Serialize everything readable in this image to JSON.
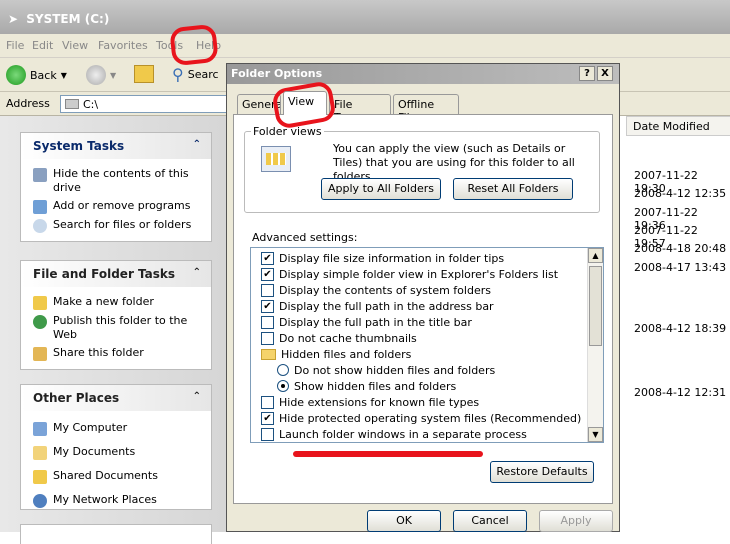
{
  "window": {
    "title": "SYSTEM (C:)"
  },
  "menu": [
    "File",
    "Edit",
    "View",
    "Favorites",
    "Tools",
    "Help"
  ],
  "toolbar": {
    "back_label": "Back",
    "search_label": "Searc"
  },
  "address": {
    "label": "Address",
    "value": "C:\\"
  },
  "left_pane": {
    "system_tasks": {
      "title": "System Tasks",
      "items": [
        "Hide the contents of this drive",
        "Add or remove programs",
        "Search for files or folders"
      ]
    },
    "file_tasks": {
      "title": "File and Folder Tasks",
      "items": [
        "Make a new folder",
        "Publish this folder to the Web",
        "Share this folder"
      ]
    },
    "other_places": {
      "title": "Other Places",
      "items": [
        "My Computer",
        "My Documents",
        "Shared Documents",
        "My Network Places"
      ]
    }
  },
  "details": {
    "column_header": "Date Modified",
    "dates": [
      "2007-11-22 19:30",
      "2008-4-12 12:35",
      "2007-11-22 19:36",
      "2007-11-22 19:57",
      "2008-4-18 20:48",
      "2008-4-17 13:43",
      "2008-4-12 18:39",
      "2008-4-12 12:31"
    ]
  },
  "dialog": {
    "title": "Folder Options",
    "help_btn": "?",
    "close_btn": "X",
    "tabs": [
      "General",
      "View",
      "File Types",
      "Offline Files"
    ],
    "active_tab": "View",
    "folder_views": {
      "legend": "Folder views",
      "text": "You can apply the view (such as Details or Tiles) that you are using for this folder to all folders.",
      "apply_btn": "Apply to All Folders",
      "reset_btn": "Reset All Folders"
    },
    "advanced_label": "Advanced settings:",
    "settings": [
      {
        "kind": "checkbox",
        "checked": true,
        "label": "Display file size information in folder tips"
      },
      {
        "kind": "checkbox",
        "checked": true,
        "label": "Display simple folder view in Explorer's Folders list"
      },
      {
        "kind": "checkbox",
        "checked": false,
        "label": "Display the contents of system folders"
      },
      {
        "kind": "checkbox",
        "checked": true,
        "label": "Display the full path in the address bar"
      },
      {
        "kind": "checkbox",
        "checked": false,
        "label": "Display the full path in the title bar"
      },
      {
        "kind": "checkbox",
        "checked": false,
        "label": "Do not cache thumbnails"
      },
      {
        "kind": "folder",
        "label": "Hidden files and folders"
      },
      {
        "kind": "radio",
        "checked": false,
        "label": "Do not show hidden files and folders"
      },
      {
        "kind": "radio",
        "checked": true,
        "label": "Show hidden files and folders"
      },
      {
        "kind": "checkbox",
        "checked": false,
        "label": "Hide extensions for known file types"
      },
      {
        "kind": "checkbox",
        "checked": true,
        "label": "Hide protected operating system files (Recommended)"
      },
      {
        "kind": "checkbox",
        "checked": false,
        "label": "Launch folder windows in a separate process"
      }
    ],
    "restore_btn": "Restore Defaults",
    "ok_btn": "OK",
    "cancel_btn": "Cancel",
    "apply_btn": "Apply"
  },
  "colors": {
    "annotation_red": "#e8141c",
    "accent": "#003c74"
  }
}
